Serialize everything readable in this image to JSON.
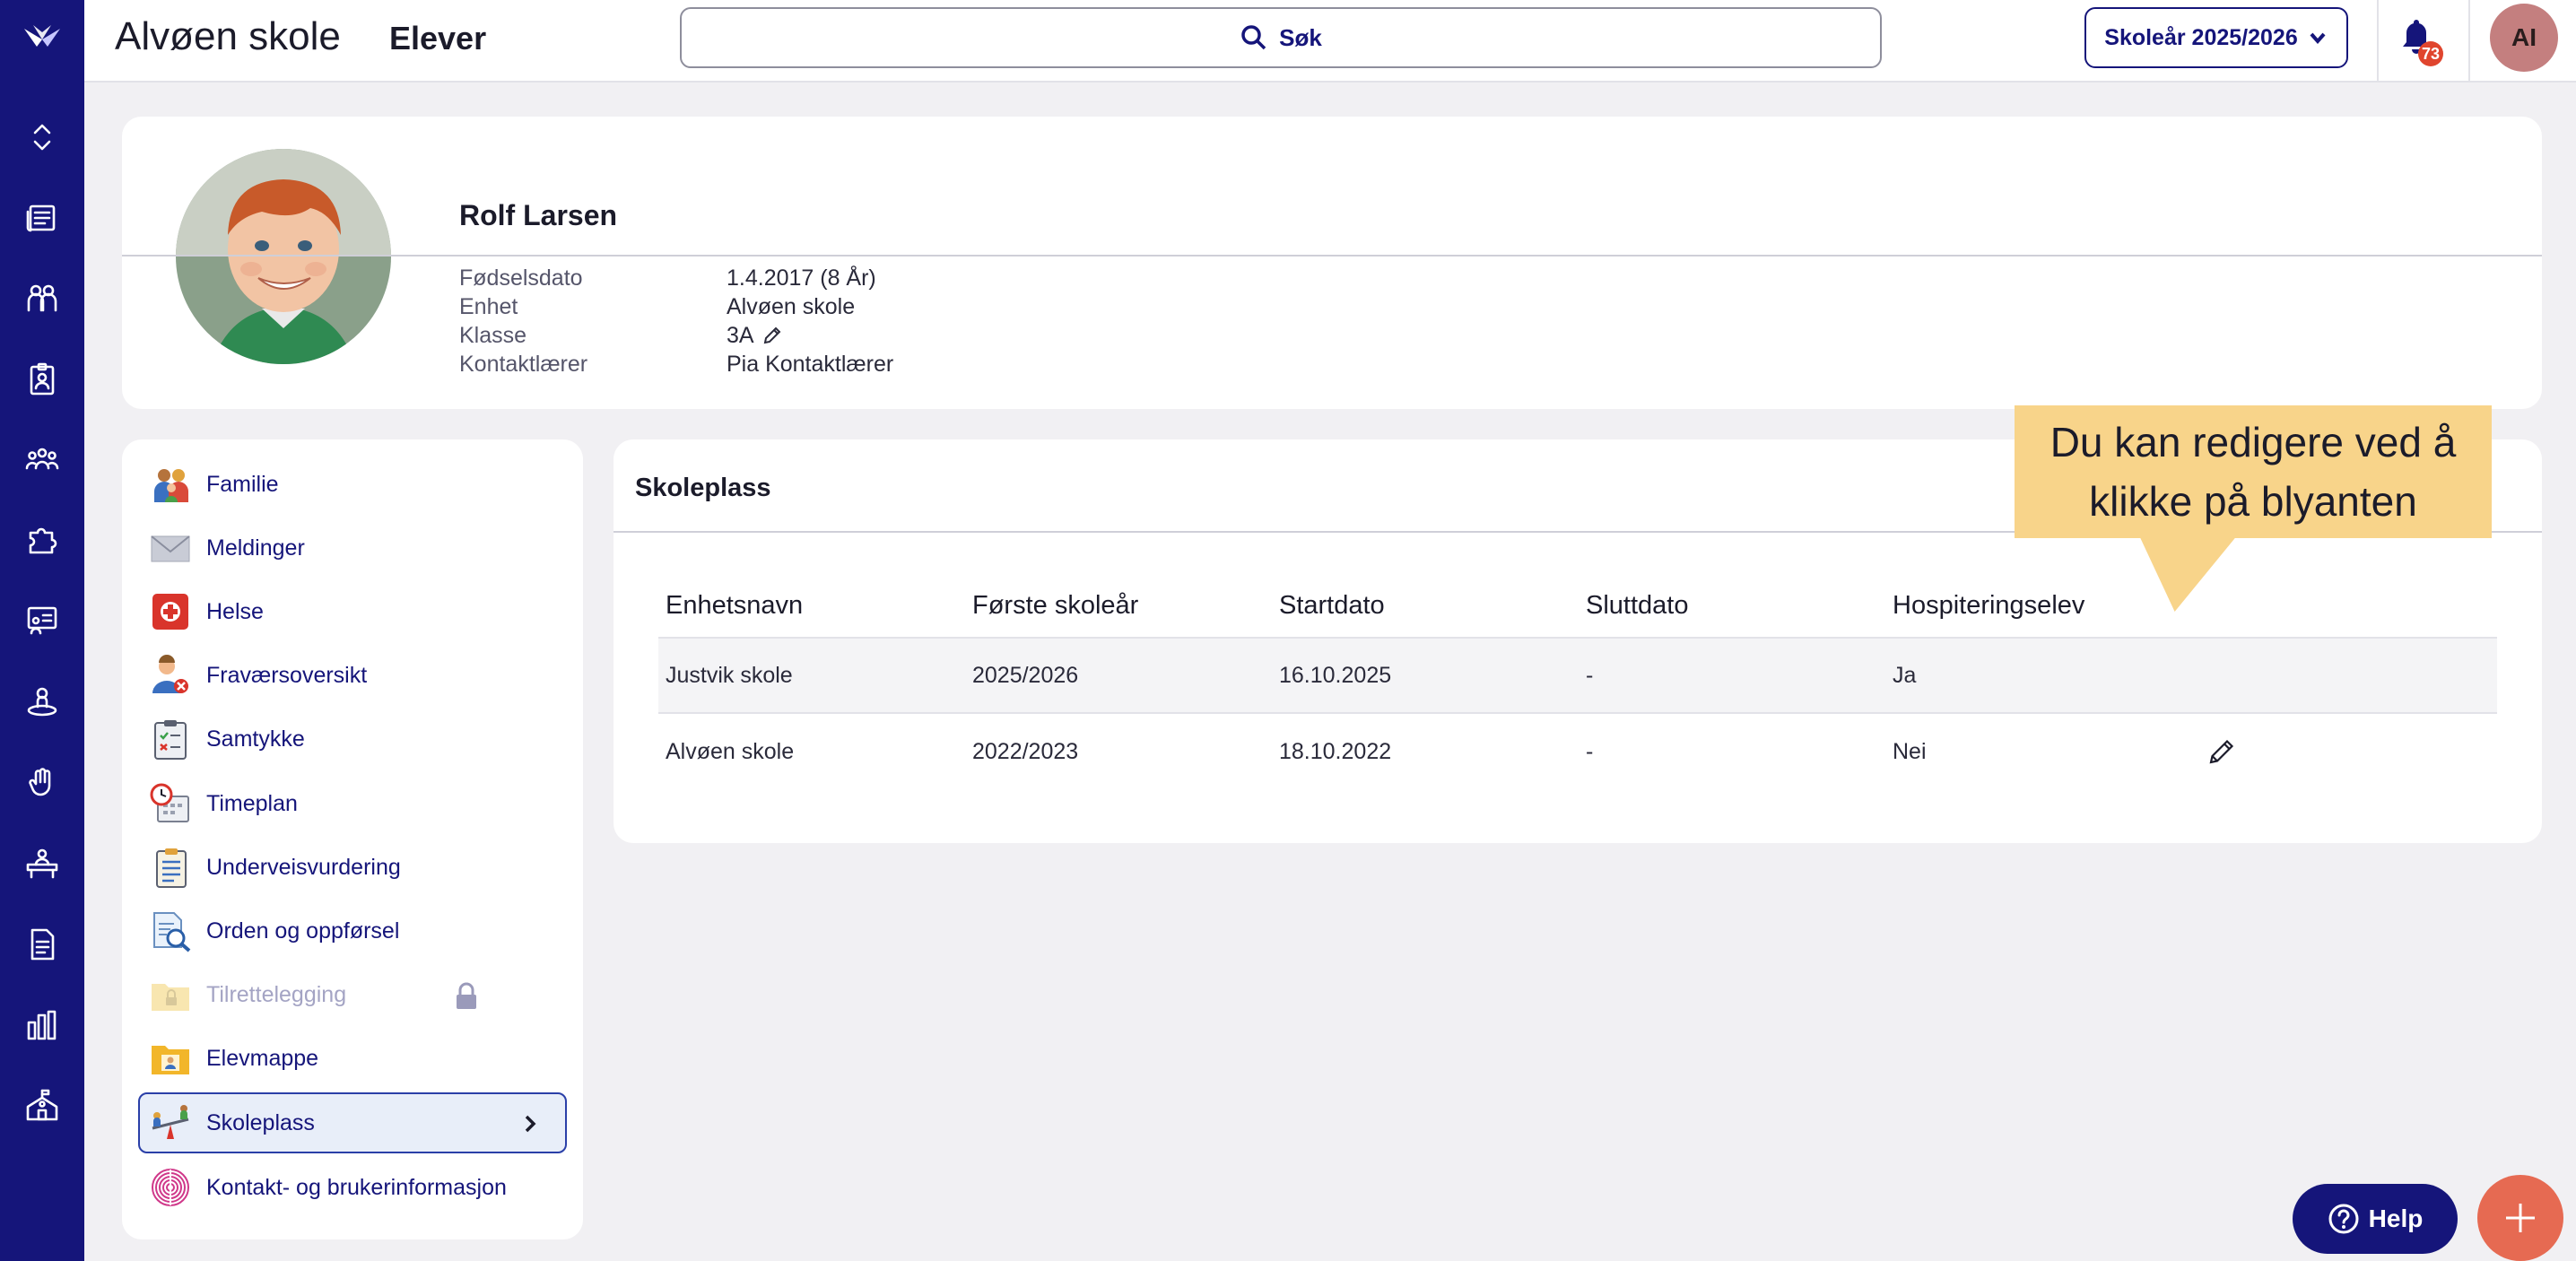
{
  "app": {
    "school_name": "Alvøen skole",
    "page_name": "Elever"
  },
  "search": {
    "label": "Søk"
  },
  "school_year": {
    "label": "Skoleår 2025/2026"
  },
  "notifications": {
    "count": "73"
  },
  "user": {
    "initials": "AI"
  },
  "rail": {
    "items": [
      "collapse-icon",
      "newspaper-icon",
      "people-icon",
      "badge-icon",
      "groups-icon",
      "puzzle-icon",
      "classroom-icon",
      "person-ring-icon",
      "hand-icon",
      "desk-icon",
      "document-icon",
      "bar-chart-icon",
      "school-icon"
    ]
  },
  "student": {
    "name": "Rolf Larsen",
    "fields": [
      {
        "label": "Fødselsdato",
        "value": "1.4.2017 (8 År)"
      },
      {
        "label": "Enhet",
        "value": "Alvøen skole"
      },
      {
        "label": "Klasse",
        "value": "3A"
      },
      {
        "label": "Kontaktlærer",
        "value": "Pia Kontaktlærer"
      }
    ]
  },
  "menu": {
    "items": [
      {
        "label": "Familie",
        "icon": "family-icon"
      },
      {
        "label": "Meldinger",
        "icon": "envelope-icon"
      },
      {
        "label": "Helse",
        "icon": "health-icon"
      },
      {
        "label": "Fraværsoversikt",
        "icon": "absence-icon"
      },
      {
        "label": "Samtykke",
        "icon": "clipboard-check-icon"
      },
      {
        "label": "Timeplan",
        "icon": "schedule-icon"
      },
      {
        "label": "Underveisvurdering",
        "icon": "assessment-icon"
      },
      {
        "label": "Orden og oppførsel",
        "icon": "conduct-icon"
      },
      {
        "label": "Tilrettelegging",
        "icon": "locked-folder-icon"
      },
      {
        "label": "Elevmappe",
        "icon": "student-folder-icon"
      },
      {
        "label": "Skoleplass",
        "icon": "seesaw-icon"
      },
      {
        "label": "Kontakt- og brukerinformasjon",
        "icon": "fingerprint-icon"
      }
    ]
  },
  "skoleplass": {
    "title": "Skoleplass",
    "columns": [
      "Enhetsnavn",
      "Første skoleår",
      "Startdato",
      "Sluttdato",
      "Hospiteringselev"
    ],
    "rows": [
      [
        "Justvik skole",
        "2025/2026",
        "16.10.2025",
        "-",
        "Ja"
      ],
      [
        "Alvøen skole",
        "2022/2023",
        "18.10.2022",
        "-",
        "Nei"
      ]
    ]
  },
  "callout": {
    "text": "Du kan redigere ved å klikke på blyanten"
  },
  "help": {
    "label": "Help"
  },
  "colors": {
    "brand": "#15157a",
    "accent": "#e66a52",
    "callout": "#f8d48a",
    "badge": "#e0452e"
  }
}
